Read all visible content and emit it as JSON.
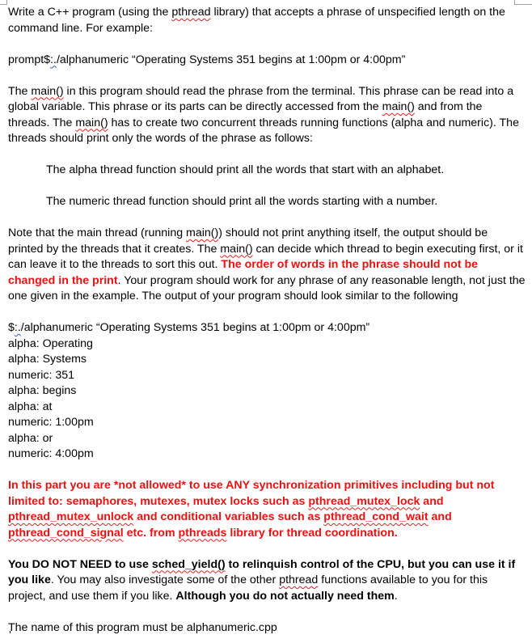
{
  "document": {
    "intro": {
      "line_prefix": "Write a C++ program (using the ",
      "pthread_word": "pthread",
      "line_suffix": " library) that accepts a phrase of unspecified length on the command line. For example:"
    },
    "prompt_example": {
      "prefix": "prompt$",
      "flagged": ":.",
      "command": "/alphanumeric “Operating Systems 351 begins at 1:00pm or 4:00pm”"
    },
    "main_para": {
      "t1": "The ",
      "main1": "main()",
      "t2": " in this program should read the phrase from the terminal. This phrase can be read into a global variable. This phrase or its parts can be directly accessed from the ",
      "main2": "main()",
      "t3": " and from the threads. The ",
      "main3": "main()",
      "t4": "  has to create two concurrent threads running functions (alpha and numeric). The threads should print only the words of the phrase as follows:"
    },
    "alpha_rule": "The alpha thread function should print all the words that start with an alphabet.",
    "numeric_rule": "The numeric thread function should print all the words starting with a number.",
    "note_para": {
      "t1": "Note that the main thread (running ",
      "main1": "main()",
      "t2": ") should not print anything itself, the output should be printed by the threads that it creates. The ",
      "main2": "main()",
      "t3": " can decide which thread to begin executing first, or it can leave it to the threads to sort this out. ",
      "red": "The order of words in the phrase should not be changed in the print",
      "t4": ". Your program should work for any phrase of any reasonable length, not just the one given in the example. The output of your program should look similar to the following"
    },
    "output_example": {
      "prefix": "$",
      "flagged": ":.",
      "command": "/alphanumeric “Operating Systems 351 begins at 1:00pm or 4:00pm”",
      "lines": [
        "alpha: Operating",
        "alpha: Systems",
        "numeric: 351",
        "alpha: begins",
        "alpha: at",
        "numeric: 1:00pm",
        "alpha: or",
        "numeric: 4:00pm"
      ]
    },
    "sync_para": {
      "t1": "In this part you are *not allowed* to use ANY synchronization primitives including but not limited to: semaphores, mutexes, mutex locks such as ",
      "f1": "pthread_mutex_lock",
      "t2": " and ",
      "f2": "pthread_mutex_unlock",
      "t3": " and conditional variables such as ",
      "f3": "pthread_cond_wait",
      "t4": " and ",
      "f4": "pthread_cond_signal",
      "t5": " etc. from ",
      "f5": "pthreads",
      "t6": " library for thread coordination."
    },
    "yield_para": {
      "b1": "You DO NOT NEED to use ",
      "f1": "sched_yield()",
      "b2": " to relinquish control of the CPU, but you can use it if you like",
      "t1": ". You may also investigate some of the other ",
      "f2": "pthread",
      "t2": " functions available to you for this project, and use them if you like. ",
      "b3": "Although you do not actually need them",
      "t3": "."
    },
    "name_line": "The name of this program must be alphanumeric.cpp"
  }
}
